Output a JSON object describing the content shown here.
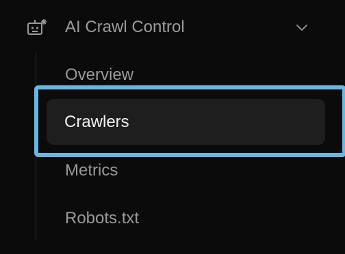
{
  "section": {
    "title": "AI Crawl Control",
    "icon": "robot-icon",
    "expanded": true
  },
  "nav": {
    "items": [
      {
        "label": "Overview",
        "active": false
      },
      {
        "label": "Crawlers",
        "active": true
      },
      {
        "label": "Metrics",
        "active": false
      },
      {
        "label": "Robots.txt",
        "active": false
      }
    ]
  },
  "colors": {
    "background": "#0b0b0b",
    "highlight_border": "#67b7e4",
    "active_item_bg": "#1e1e1e",
    "active_text": "#f2f2f2",
    "inactive_text": "#9a9a9a"
  }
}
